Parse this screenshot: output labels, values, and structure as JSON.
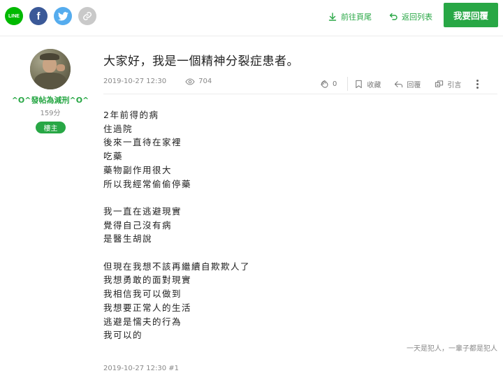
{
  "share": {
    "line_label": "LINE",
    "facebook_label": "f"
  },
  "nav": {
    "goto_end": "前往頁尾",
    "back_to_list": "返回列表",
    "reply_button": "我要回覆"
  },
  "author": {
    "name": "^O^發帖為減刑^O^",
    "score": "159分",
    "badge": "樓主"
  },
  "post": {
    "title": "大家好，我是一個精神分裂症患者。",
    "date": "2019-10-27 12:30",
    "views": "704",
    "actions": {
      "like_count": "0",
      "favorite": "收藏",
      "reply": "回覆",
      "quote": "引言"
    },
    "paragraphs": [
      [
        "2年前得的病",
        "住過院",
        "後來一直待在家裡",
        "吃藥",
        "藥物副作用很大",
        "所以我經常偷偷停藥"
      ],
      [
        "我一直在逃避現實",
        "覺得自己沒有病",
        "是醫生胡說"
      ],
      [
        "但現在我想不該再繼續自欺欺人了",
        "我想勇敢的面對現實",
        "我相信我可以做到",
        "我想要正常人的生活",
        "逃避是懦夫的行為",
        "我可以的"
      ]
    ],
    "signature": "一天是犯人，一輩子都是犯人",
    "footer": "2019-10-27 12:30 #1"
  },
  "colors": {
    "accent": "#28a745",
    "line": "#00b900",
    "facebook": "#3b5998",
    "twitter": "#55acee"
  }
}
